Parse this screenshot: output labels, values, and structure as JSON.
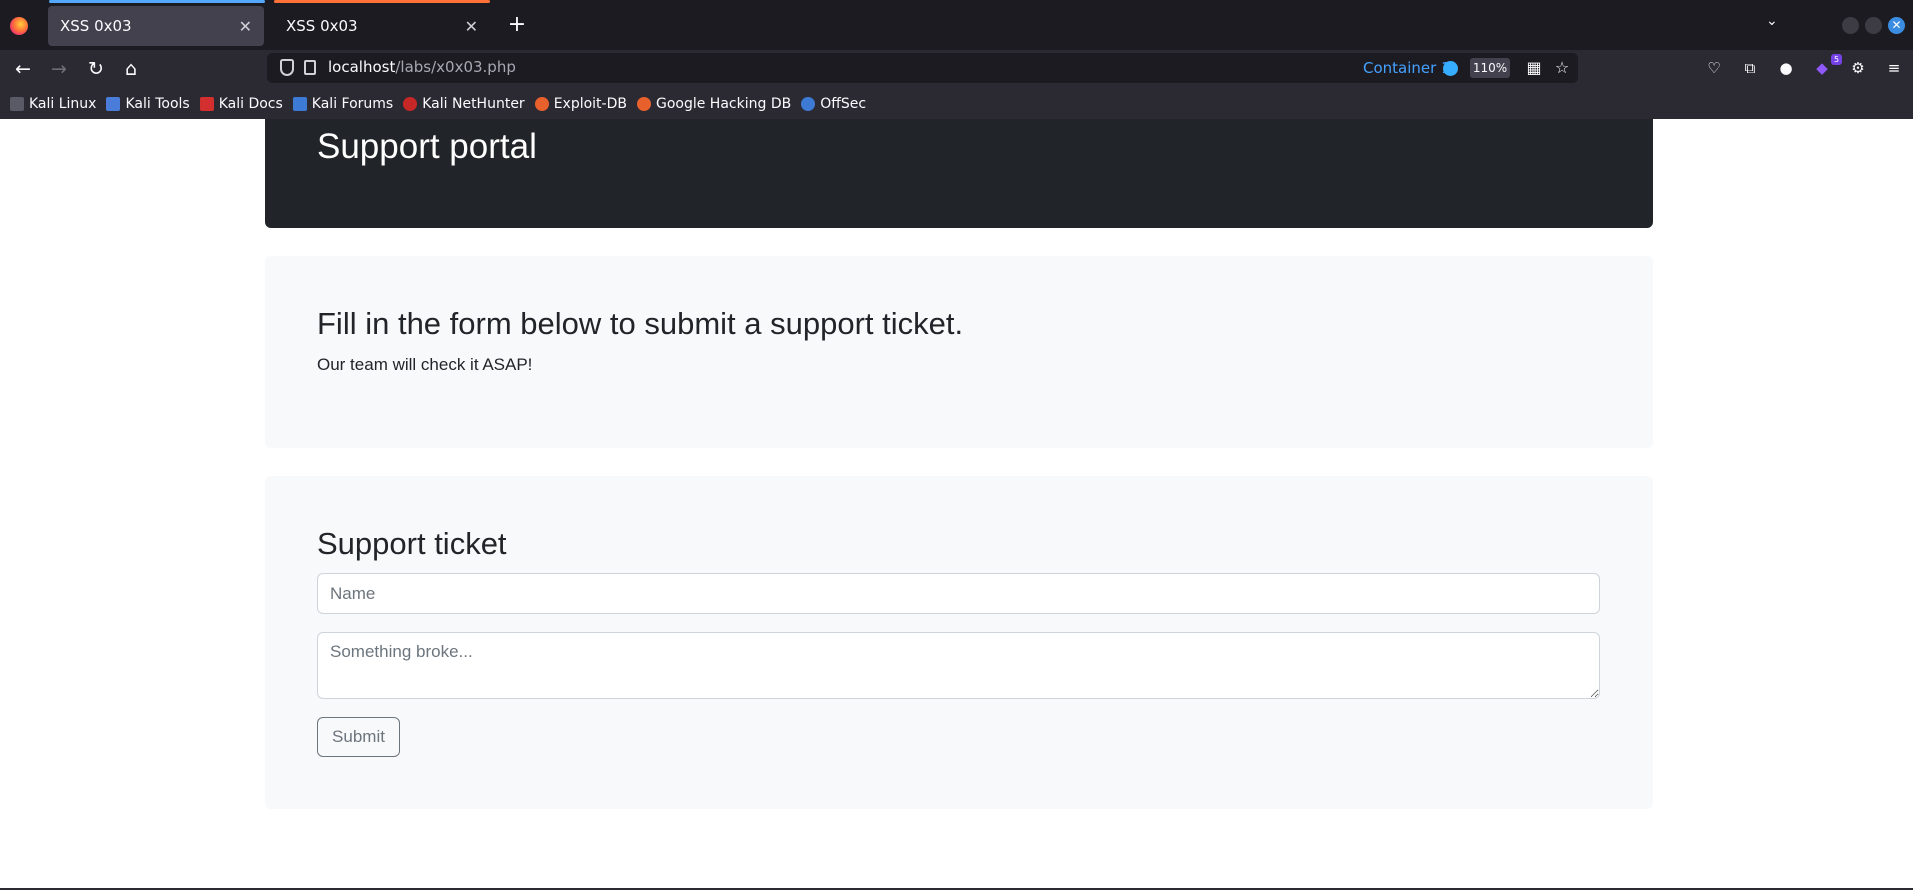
{
  "browser": {
    "tabs": [
      {
        "title": "XSS 0x03",
        "active": true
      },
      {
        "title": "XSS 0x03",
        "active": false
      }
    ],
    "url": {
      "host": "localhost",
      "path": "/labs/x0x03.php"
    },
    "container": "Container 1",
    "zoom": "110%",
    "extension_badge": "5",
    "bookmarks": [
      "Kali Linux",
      "Kali Tools",
      "Kali Docs",
      "Kali Forums",
      "Kali NetHunter",
      "Exploit-DB",
      "Google Hacking DB",
      "OffSec"
    ]
  },
  "page": {
    "hero_title": "Support portal",
    "intro": {
      "heading": "Fill in the form below to submit a support ticket.",
      "text": "Our team will check it ASAP!"
    },
    "form": {
      "heading": "Support ticket",
      "name_placeholder": "Name",
      "message_placeholder": "Something broke...",
      "submit_label": "Submit"
    }
  },
  "colors": {
    "hero_bg": "#212529",
    "card_bg": "#f8f9fa",
    "container_accent": "#45a1ff",
    "chrome_bg": "#2b2a33"
  }
}
